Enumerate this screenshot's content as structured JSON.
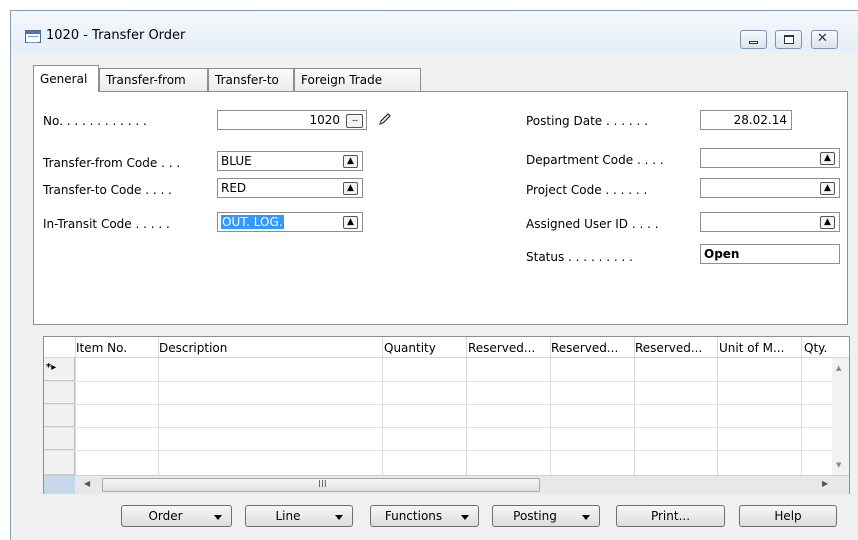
{
  "window": {
    "title": "1020 - Transfer Order",
    "controls": {
      "minimize": "minimize",
      "maximize": "maximize",
      "close": "close"
    }
  },
  "tabs": [
    {
      "label": "General",
      "active": true
    },
    {
      "label": "Transfer-from",
      "active": false
    },
    {
      "label": "Transfer-to",
      "active": false
    },
    {
      "label": "Foreign Trade",
      "active": false
    }
  ],
  "general": {
    "no": {
      "label": "No. . . . . . . . . . . .",
      "value": "1020"
    },
    "transfer_from_code": {
      "label": "Transfer-from Code . . .",
      "value": "BLUE"
    },
    "transfer_to_code": {
      "label": "Transfer-to Code . . . .",
      "value": "RED"
    },
    "in_transit_code": {
      "label": "In-Transit Code . . . . .",
      "value": "OUT. LOG."
    },
    "posting_date": {
      "label": "Posting Date . . . . . .",
      "value": "28.02.14"
    },
    "department_code": {
      "label": "Department Code . . . .",
      "value": ""
    },
    "project_code": {
      "label": "Project Code . . . . . .",
      "value": ""
    },
    "assigned_user_id": {
      "label": "Assigned User ID . . . .",
      "value": ""
    },
    "status": {
      "label": "Status . . . . . . . . .",
      "value": "Open"
    }
  },
  "lines": {
    "columns": [
      "Item No.",
      "Description",
      "Quantity",
      "Reserved...",
      "Reserved...",
      "Reserved...",
      "Unit of M...",
      "Qty."
    ],
    "new_row_marker": "*▸",
    "scroll_grip": "III"
  },
  "actions": {
    "order": "Order",
    "line": "Line",
    "functions": "Functions",
    "posting": "Posting",
    "print": "Print...",
    "help": "Help"
  },
  "colors": {
    "selection": "#3399ff",
    "window_bg": "#f0f0f0"
  }
}
